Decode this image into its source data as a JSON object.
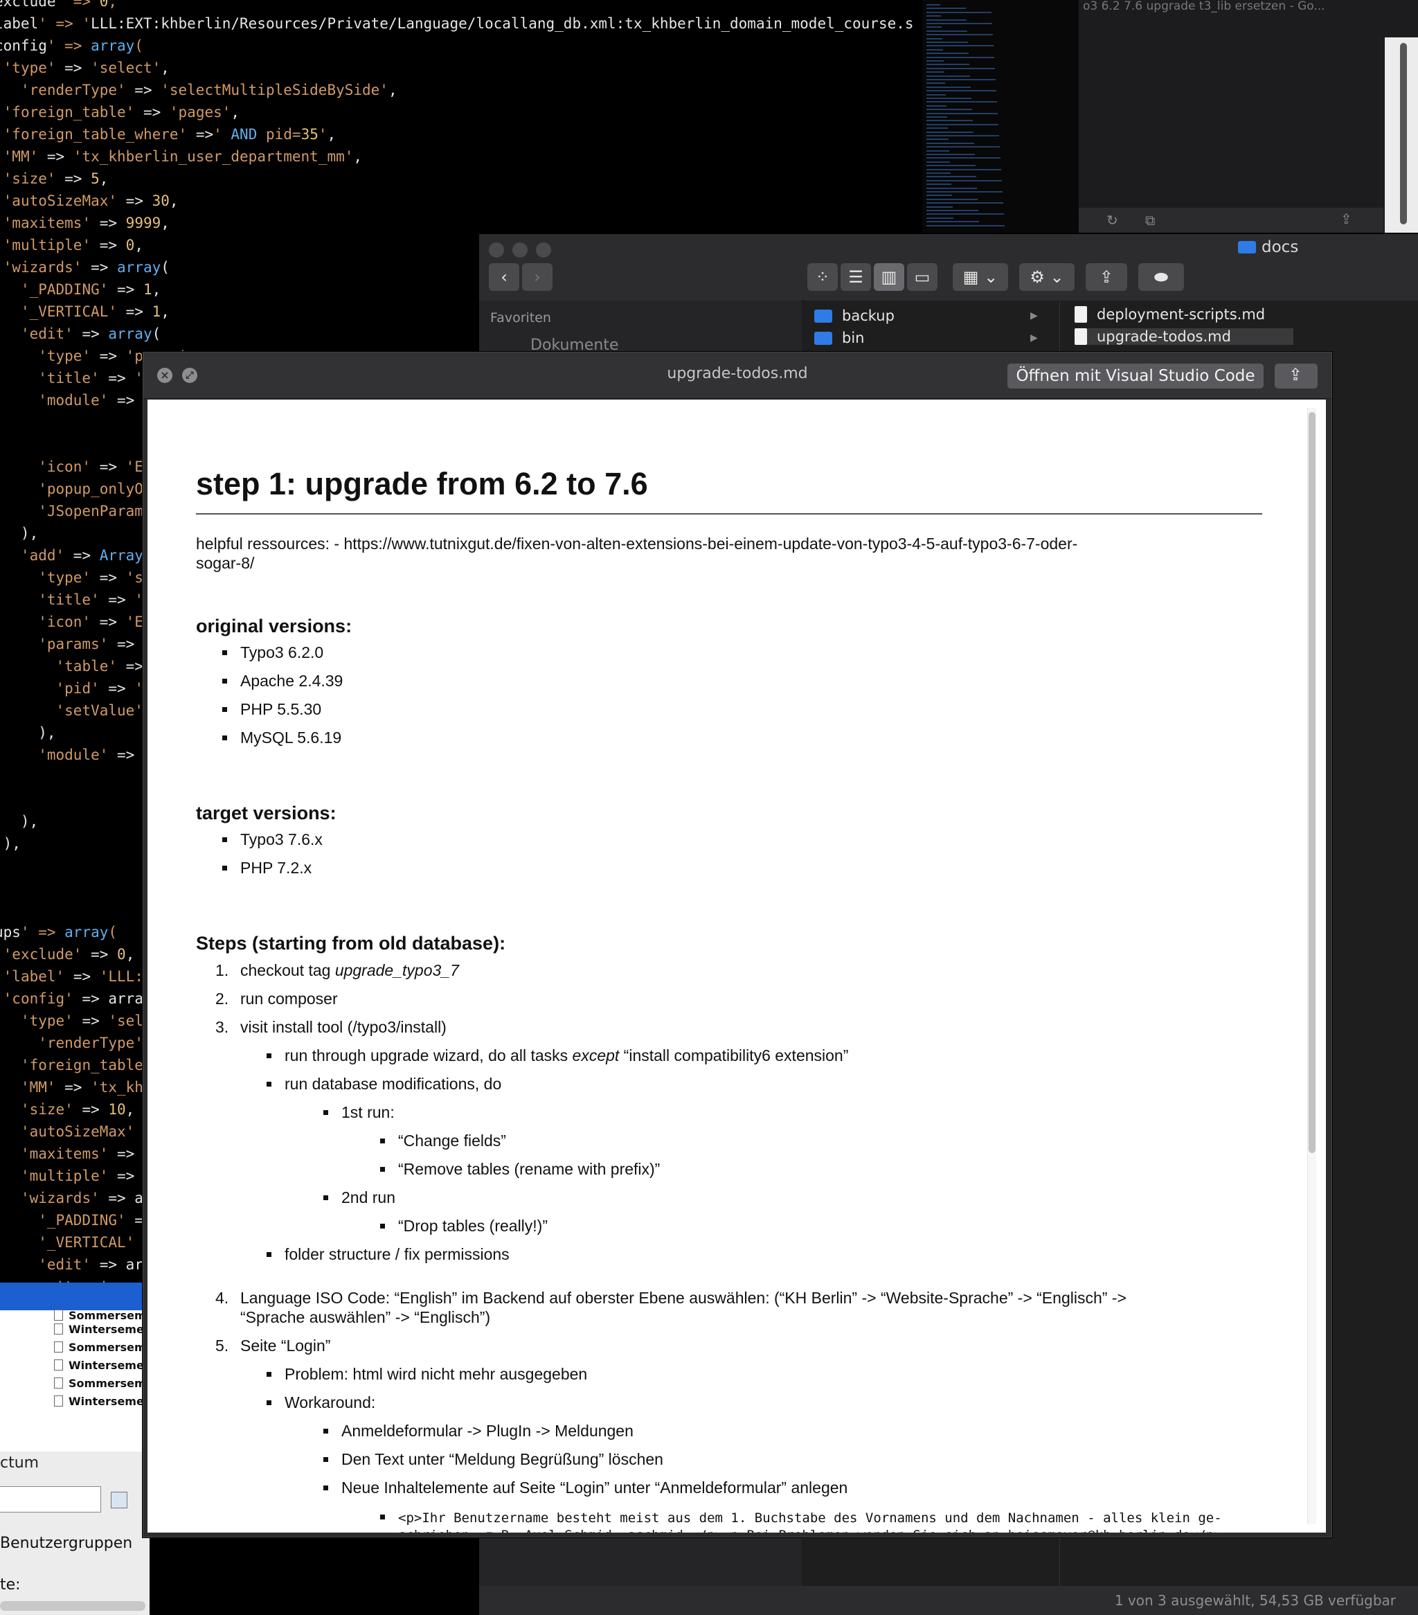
{
  "editor": {
    "lines": [
      "exclude' => 0,",
      "label' => 'LLL:EXT:khberlin/Resources/Private/Language/locallang_db.xml:tx_khberlin_domain_model_course.s",
      "config' => array(",
      " 'type' => 'select',",
      "   'renderType' => 'selectMultipleSideBySide',",
      " 'foreign_table' => 'pages',",
      " 'foreign_table_where' =>' AND pid=35',",
      " 'MM' => 'tx_khberlin_user_department_mm',",
      " 'size' => 5,",
      " 'autoSizeMax' => 30,",
      " 'maxitems' => 9999,",
      " 'multiple' => 0,",
      " 'wizards' => array(",
      "   '_PADDING' => 1,",
      "   '_VERTICAL' => 1,",
      "   'edit' => array(",
      "     'type' => 'popup',",
      "     'title' => '",
      "     'module' =>",
      "",
      "",
      "     'icon' => 'E",
      "     'popup_onlyO",
      "     'JSopenParam",
      "   ),",
      "   'add' => Array",
      "     'type' => 's",
      "     'title' => '",
      "     'icon' => 'E",
      "     'params' =>",
      "       'table' =>",
      "       'pid' => '",
      "       'setValue'",
      "     ),",
      "     'module' =>",
      "",
      "",
      "   ),",
      " ),",
      "",
      "",
      "",
      "ups' => array(",
      " 'exclude' => 0,",
      " 'label' => 'LLL:",
      " 'config' => arra",
      "   'type' => 'sel",
      "     'renderType'",
      "   'foreign_table",
      "   'MM' => 'tx_kh",
      "   'size' => 10,",
      "   'autoSizeMax'",
      "   'maxitems' =>",
      "   'multiple' =>",
      "   'wizards' => a",
      "     '_PADDING' =",
      "     '_VERTICAL'",
      "     'edit' => ar",
      "       'type' =>"
    ]
  },
  "browser": {
    "tab_title": "o3 6.2 7.6 upgrade t3_lib ersetzen - Go..."
  },
  "oldwin": {
    "rows": [
      "Sommersemester",
      "Wintersemester",
      "Sommersemester",
      "Wintersemester",
      "Sommersemester",
      "Wintersemester"
    ],
    "label_top": "ctum",
    "label_groups": "Benutzergruppen",
    "label_bottom": "te:"
  },
  "finder": {
    "title": "docs",
    "sidebar_header": "Favoriten",
    "sidebar_item": "Dokumente",
    "folders": [
      "backup",
      "bin"
    ],
    "files": [
      "deployment-scripts.md",
      "upgrade-todos.md"
    ],
    "status": "1 von 3 ausgewählt, 54,53 GB verfügbar"
  },
  "quicklook": {
    "title": "upgrade-todos.md",
    "open_button": "Öffnen mit Visual Studio Code"
  },
  "doc": {
    "h1": "step 1: upgrade from 6.2 to 7.6",
    "helpful_line1": "helpful ressources: - https://www.tutnixgut.de/fixen-von-alten-extensions-bei-einem-update-von-typo3-4-5-auf-typo3-6-7-oder-",
    "helpful_line2": "sogar-8/",
    "h2_original": "original versions:",
    "original": [
      "Typo3 6.2.0",
      "Apache 2.4.39",
      "PHP 5.5.30",
      "MySQL 5.6.19"
    ],
    "h2_target": "target versions:",
    "target": [
      "Typo3 7.6.x",
      "PHP 7.2.x"
    ],
    "h2_steps": "Steps (starting from old database):",
    "steps": {
      "s1_num": "1.",
      "s1_pre": "checkout tag ",
      "s1_em": "upgrade_typo3_7",
      "s2_num": "2.",
      "s2": "run composer",
      "s3_num": "3.",
      "s3": "visit install tool (/typo3/install)",
      "s3a_pre": "run through upgrade wizard, do all tasks ",
      "s3a_em": "except",
      "s3a_post": " “install compatibility6 extension”",
      "s3b": "run database modifications, do",
      "s3b1": "1st run:",
      "s3b1a": "“Change fields”",
      "s3b1b": "“Remove tables (rename with prefix)”",
      "s3b2": "2nd run",
      "s3b2a": "“Drop tables (really!)”",
      "s3c": "folder structure / fix permissions",
      "s4_num": "4.",
      "s4_line1": "Language ISO Code: “English” im Backend auf oberster Ebene auswählen: (“KH Berlin” -> “Website-Sprache” -> “Englisch” ->",
      "s4_line2": "“Sprache auswählen” -> “Englisch”)",
      "s5_num": "5.",
      "s5": "Seite “Login”",
      "s5a": "Problem: html wird nicht mehr ausgegeben",
      "s5b": "Workaround:",
      "s5b1": "Anmeldeformular -> PlugIn -> Meldungen",
      "s5b2": "Den Text unter “Meldung Begrüßung” löschen",
      "s5b3": "Neue Inhaltelemente auf Seite “Login” unter “Anmeldeformular” anlegen",
      "s5b3a_line1": "<p>Ihr Benutzername besteht meist aus dem 1. Buchstabe des Vornamens und dem Nachnamen - alles klein ge-",
      "s5b3a_line2": "schrieben, z.B. Axel Schmid: aschmid.</p><p>Bei Problemen wenden Sie sich an heissmeyer@kh-berlin.de</p>"
    }
  }
}
